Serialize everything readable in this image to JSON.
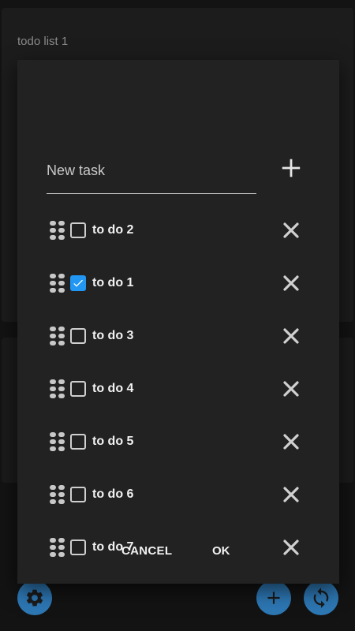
{
  "background": {
    "card_title": "todo list 1",
    "accent_color": "#2d77b3"
  },
  "dialog": {
    "new_task_placeholder": "New task",
    "new_task_value": "",
    "tasks": [
      {
        "label": "to do 2",
        "checked": false
      },
      {
        "label": "to do 1",
        "checked": true
      },
      {
        "label": "to do 3",
        "checked": false
      },
      {
        "label": "to do 4",
        "checked": false
      },
      {
        "label": "to do 5",
        "checked": false
      },
      {
        "label": "to do 6",
        "checked": false
      },
      {
        "label": "to do 7",
        "checked": false
      }
    ],
    "cancel_label": "CANCEL",
    "ok_label": "OK",
    "checkbox_color": "#2196f3"
  },
  "icons": {
    "add_task": "plus-icon",
    "drag": "drag-handle-icon",
    "delete": "close-icon",
    "settings": "gear-icon",
    "add_list": "plus-icon",
    "sync": "sync-icon"
  }
}
